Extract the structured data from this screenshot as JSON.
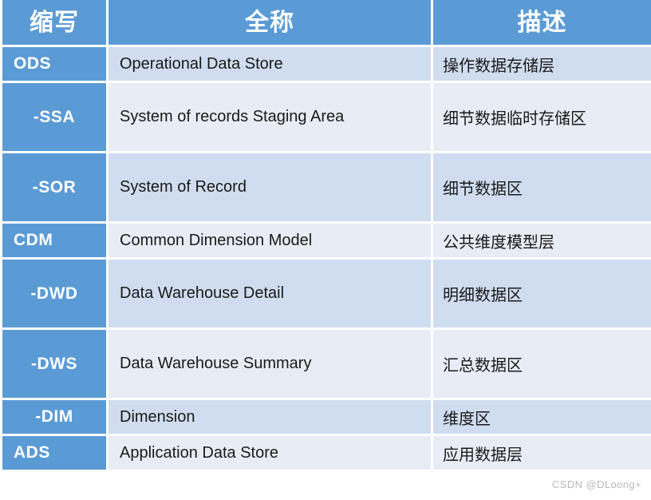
{
  "table": {
    "columns": [
      {
        "key": "abbr",
        "label": "缩写"
      },
      {
        "key": "full",
        "label": "全称"
      },
      {
        "key": "desc",
        "label": "描述"
      }
    ],
    "rows": [
      {
        "abbr": "ODS",
        "full": "Operational Data Store",
        "desc": "操作数据存储层",
        "indent": false,
        "height": "short",
        "shade": "dark"
      },
      {
        "abbr": "-SSA",
        "full": "System of records Staging Area",
        "desc": "细节数据临时存储区",
        "indent": true,
        "height": "tall",
        "shade": "light"
      },
      {
        "abbr": "-SOR",
        "full": "System of Record",
        "desc": "细节数据区",
        "indent": true,
        "height": "tall",
        "shade": "dark"
      },
      {
        "abbr": "CDM",
        "full": "Common Dimension Model",
        "desc": "公共维度模型层",
        "indent": false,
        "height": "short",
        "shade": "light"
      },
      {
        "abbr": "-DWD",
        "full": "Data Warehouse Detail",
        "desc": "明细数据区",
        "indent": true,
        "height": "tall",
        "shade": "dark"
      },
      {
        "abbr": "-DWS",
        "full": "Data Warehouse Summary",
        "desc": "汇总数据区",
        "indent": true,
        "height": "tall",
        "shade": "light"
      },
      {
        "abbr": "-DIM",
        "full": "Dimension",
        "desc": "维度区",
        "indent": true,
        "height": "short",
        "shade": "dark"
      },
      {
        "abbr": "ADS",
        "full": "Application Data Store",
        "desc": "应用数据层",
        "indent": false,
        "height": "short",
        "shade": "light"
      }
    ]
  },
  "watermark": {
    "text": "CSDN @DLoong+"
  },
  "colors": {
    "header_blue": "#5B9BD5",
    "abbr_blue": "#5B9BD5",
    "row_shade_dark": "#D0DCEF",
    "row_shade_light": "#E8ECF5",
    "gap_white": "#FFFFFF",
    "text_dark": "#1A1A1A",
    "text_white": "#FFFFFF",
    "watermark_gray": "#B9B9B9"
  }
}
